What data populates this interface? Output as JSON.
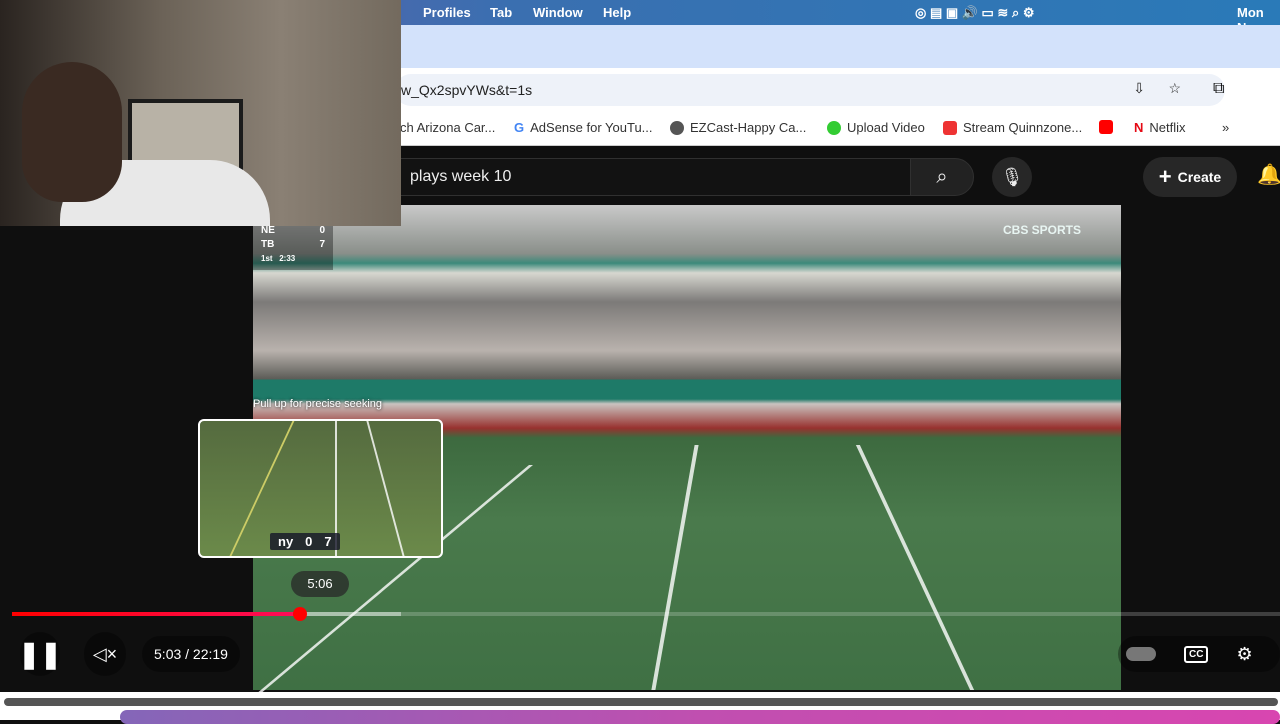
{
  "menubar": {
    "items": [
      "Profiles",
      "Tab",
      "Window",
      "Help"
    ],
    "clock": "Mon No"
  },
  "browser": {
    "url": "w_Qx2spvYWs&t=1s",
    "bookmarks": [
      "ch Arizona Car...",
      "AdSense for YouTu...",
      "EZCast-Happy Ca...",
      "Upload Video",
      "Stream Quinnzone...",
      "Netflix"
    ],
    "more": "»"
  },
  "youtube": {
    "search_value": "plays week 10",
    "create_label": "Create"
  },
  "video": {
    "scorebug": {
      "team1": "NE",
      "score1": "0",
      "team2": "TB",
      "score2": "7",
      "quarter": "1st",
      "clock": "2:33"
    },
    "network": "CBS SPORTS",
    "seek_hint": "Pull up for precise seeking",
    "preview_score": {
      "team1": "ny",
      "score1": "0",
      "score2": "7"
    },
    "tooltip_time": "5:06",
    "progress": {
      "played_fraction": 0.227,
      "buffered_fraction": 0.307
    },
    "time_display": "5:03 / 22:19"
  },
  "colors": {
    "accent": "#ff0000"
  }
}
